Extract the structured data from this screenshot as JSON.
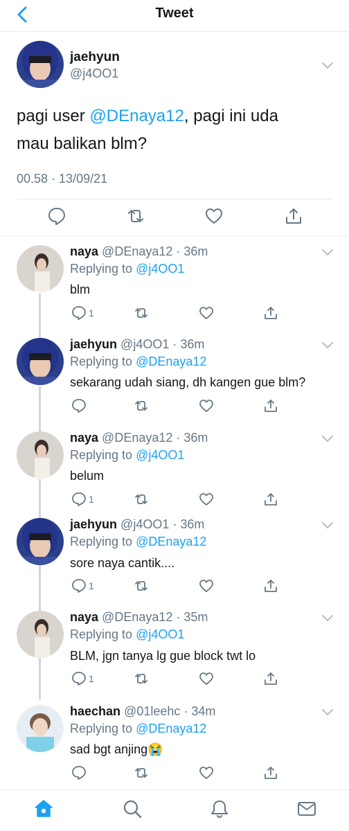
{
  "header": {
    "title": "Tweet"
  },
  "main_tweet": {
    "name": "jaehyun",
    "handle": "@j4OO1",
    "text_before": "pagi user ",
    "mention": "@DEnaya12",
    "text_line1_after": ", pagi ini uda",
    "text_line2": "mau balikan blm?",
    "timestamp": "00.58 · 13/09/21"
  },
  "replies": [
    {
      "name": "naya",
      "meta": "@DEnaya12 · 36m",
      "replying_prefix": "Replying to ",
      "replying_to": "@j4OO1",
      "text": "blm",
      "reply_count": "1"
    },
    {
      "name": "jaehyun",
      "meta": "@j4OO1 · 36m",
      "replying_prefix": "Replying to ",
      "replying_to": "@DEnaya12",
      "text": "sekarang udah siang, dh kangen gue blm?",
      "reply_count": ""
    },
    {
      "name": "naya",
      "meta": "@DEnaya12 · 36m",
      "replying_prefix": "Replying to ",
      "replying_to": "@j4OO1",
      "text": "belum",
      "reply_count": "1"
    },
    {
      "name": "jaehyun",
      "meta": "@j4OO1 · 36m",
      "replying_prefix": "Replying to ",
      "replying_to": "@DEnaya12",
      "text": "sore naya cantik....",
      "reply_count": "1"
    },
    {
      "name": "naya",
      "meta": "@DEnaya12 · 35m",
      "replying_prefix": "Replying to ",
      "replying_to": "@j4OO1",
      "text": "BLM, jgn tanya lg gue block twt lo",
      "reply_count": "1"
    },
    {
      "name": "haechan",
      "meta": "@01leehc · 34m",
      "replying_prefix": "Replying to ",
      "replying_to": "@DEnaya12",
      "text": "sad bgt anjing😭",
      "reply_count": ""
    }
  ],
  "icons": {
    "back": "chevron-left-icon",
    "reply": "reply-icon",
    "retweet": "retweet-icon",
    "like": "heart-icon",
    "share": "share-icon",
    "home": "home-icon",
    "search": "search-icon",
    "notifications": "bell-icon",
    "messages": "mail-icon"
  },
  "colors": {
    "accent": "#1da1f2",
    "secondary_text": "#657786",
    "divider": "#e6ecf0",
    "thread_line": "#ccd6dd"
  }
}
